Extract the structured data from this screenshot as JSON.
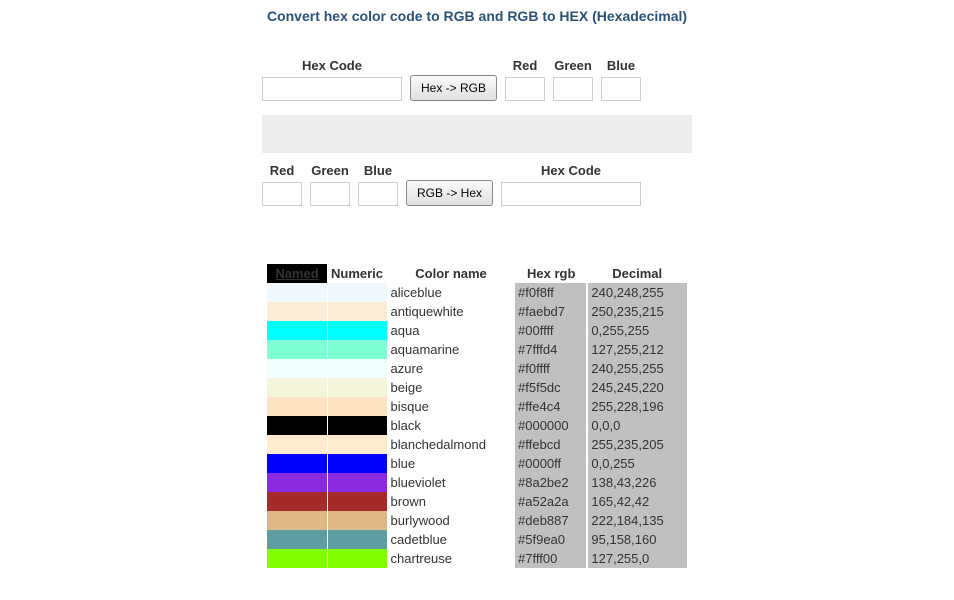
{
  "title": "Convert hex color code to RGB and RGB to HEX (Hexadecimal)",
  "converter": {
    "top": {
      "hex_label": "Hex Code",
      "red_label": "Red",
      "green_label": "Green",
      "blue_label": "Blue",
      "button": "Hex -> RGB"
    },
    "bottom": {
      "red_label": "Red",
      "green_label": "Green",
      "blue_label": "Blue",
      "hex_label": "Hex Code",
      "button": "RGB -> Hex"
    }
  },
  "table": {
    "headers": {
      "named": "Named",
      "numeric": "Numeric",
      "colorname": "Color name",
      "hexrgb": "Hex rgb",
      "decimal": "Decimal"
    },
    "rows": [
      {
        "color": "#f0f8ff",
        "name": "aliceblue",
        "hex": "#f0f8ff",
        "dec": "240,248,255"
      },
      {
        "color": "#faebd7",
        "name": "antiquewhite",
        "hex": "#faebd7",
        "dec": "250,235,215"
      },
      {
        "color": "#00ffff",
        "name": "aqua",
        "hex": "#00ffff",
        "dec": "0,255,255"
      },
      {
        "color": "#7fffd4",
        "name": "aquamarine",
        "hex": "#7fffd4",
        "dec": "127,255,212"
      },
      {
        "color": "#f0ffff",
        "name": "azure",
        "hex": "#f0ffff",
        "dec": "240,255,255"
      },
      {
        "color": "#f5f5dc",
        "name": "beige",
        "hex": "#f5f5dc",
        "dec": "245,245,220"
      },
      {
        "color": "#ffe4c4",
        "name": "bisque",
        "hex": "#ffe4c4",
        "dec": "255,228,196"
      },
      {
        "color": "#000000",
        "name": "black",
        "hex": "#000000",
        "dec": "0,0,0"
      },
      {
        "color": "#ffebcd",
        "name": "blanchedalmond",
        "hex": "#ffebcd",
        "dec": "255,235,205"
      },
      {
        "color": "#0000ff",
        "name": "blue",
        "hex": "#0000ff",
        "dec": "0,0,255"
      },
      {
        "color": "#8a2be2",
        "name": "blueviolet",
        "hex": "#8a2be2",
        "dec": "138,43,226"
      },
      {
        "color": "#a52a2a",
        "name": "brown",
        "hex": "#a52a2a",
        "dec": "165,42,42"
      },
      {
        "color": "#deb887",
        "name": "burlywood",
        "hex": "#deb887",
        "dec": "222,184,135"
      },
      {
        "color": "#5f9ea0",
        "name": "cadetblue",
        "hex": "#5f9ea0",
        "dec": "95,158,160"
      },
      {
        "color": "#7fff00",
        "name": "chartreuse",
        "hex": "#7fff00",
        "dec": "127,255,0"
      }
    ]
  }
}
